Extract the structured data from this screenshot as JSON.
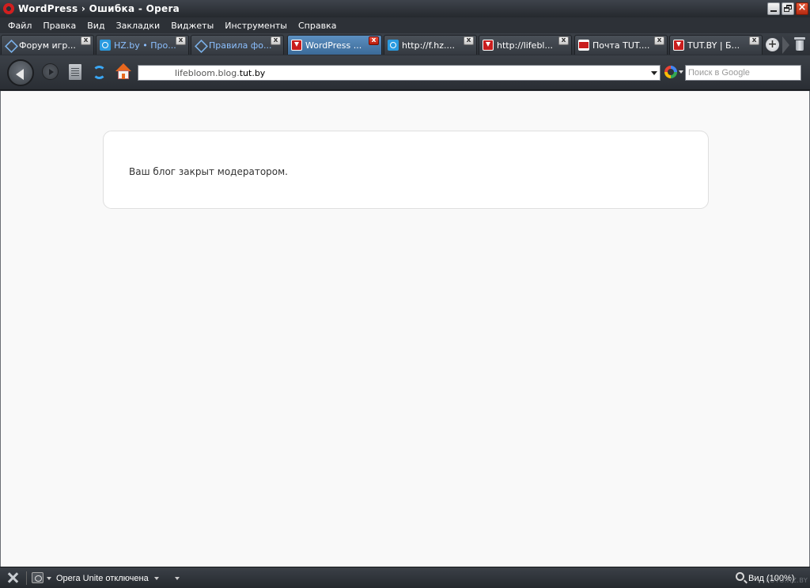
{
  "window": {
    "title": "WordPress › Ошибка - Opera"
  },
  "menu": {
    "items": [
      "Файл",
      "Правка",
      "Вид",
      "Закладки",
      "Виджеты",
      "Инструменты",
      "Справка"
    ]
  },
  "tabs": [
    {
      "label": "Форум игр...",
      "icon": "forum-icon",
      "active": false
    },
    {
      "label": "HZ.by • Про...",
      "icon": "hz-icon",
      "active": false
    },
    {
      "label": "Правила фо...",
      "icon": "forum-icon",
      "active": false
    },
    {
      "label": "WordPress ...",
      "icon": "tutby-icon",
      "active": true
    },
    {
      "label": "http://f.hz....",
      "icon": "hz-icon",
      "active": false
    },
    {
      "label": "http://lifebl...",
      "icon": "tutby-icon",
      "active": false
    },
    {
      "label": "Почта TUT....",
      "icon": "mail-icon",
      "active": false
    },
    {
      "label": "TUT.BY | Б...",
      "icon": "tutby-icon",
      "active": false
    }
  ],
  "toolbar": {
    "tab_close_glyph": "x",
    "new_tab_glyph": "+"
  },
  "address": {
    "prefix": "lifebloom.blog.",
    "domain": "tut.by"
  },
  "search": {
    "placeholder": "Поиск в Google"
  },
  "page": {
    "message": "Ваш блог закрыт модератором."
  },
  "status": {
    "unite": "Opera Unite отключена",
    "zoom": "Вид (100%)",
    "watermark": "FOTO.HZ.BY"
  },
  "colors": {
    "accent_active_tab": "#4a7eb0",
    "opera_red": "#d21f1f",
    "page_background": "#f9f9f9"
  }
}
